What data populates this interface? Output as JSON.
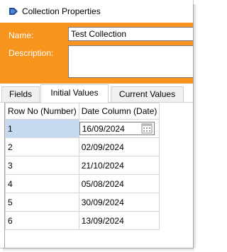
{
  "window": {
    "title": "Collection Properties"
  },
  "form": {
    "name_label": "Name:",
    "name_value": "Test Collection",
    "description_label": "Description:",
    "description_value": ""
  },
  "tabs": [
    {
      "label": "Fields",
      "active": false
    },
    {
      "label": "Initial Values",
      "active": true
    },
    {
      "label": "Current Values",
      "active": false
    }
  ],
  "grid": {
    "columns": [
      "Row No  (Number)",
      "Date Column  (Date)"
    ],
    "rows": [
      {
        "row_no": "1",
        "date": "16/09/2024"
      },
      {
        "row_no": "2",
        "date": "02/09/2024"
      },
      {
        "row_no": "3",
        "date": "21/10/2024"
      },
      {
        "row_no": "4",
        "date": "05/08/2024"
      },
      {
        "row_no": "5",
        "date": "30/09/2024"
      },
      {
        "row_no": "6",
        "date": "13/09/2024"
      }
    ]
  },
  "colors": {
    "header_band": "#f7941d",
    "selection": "#c5d9f1"
  }
}
